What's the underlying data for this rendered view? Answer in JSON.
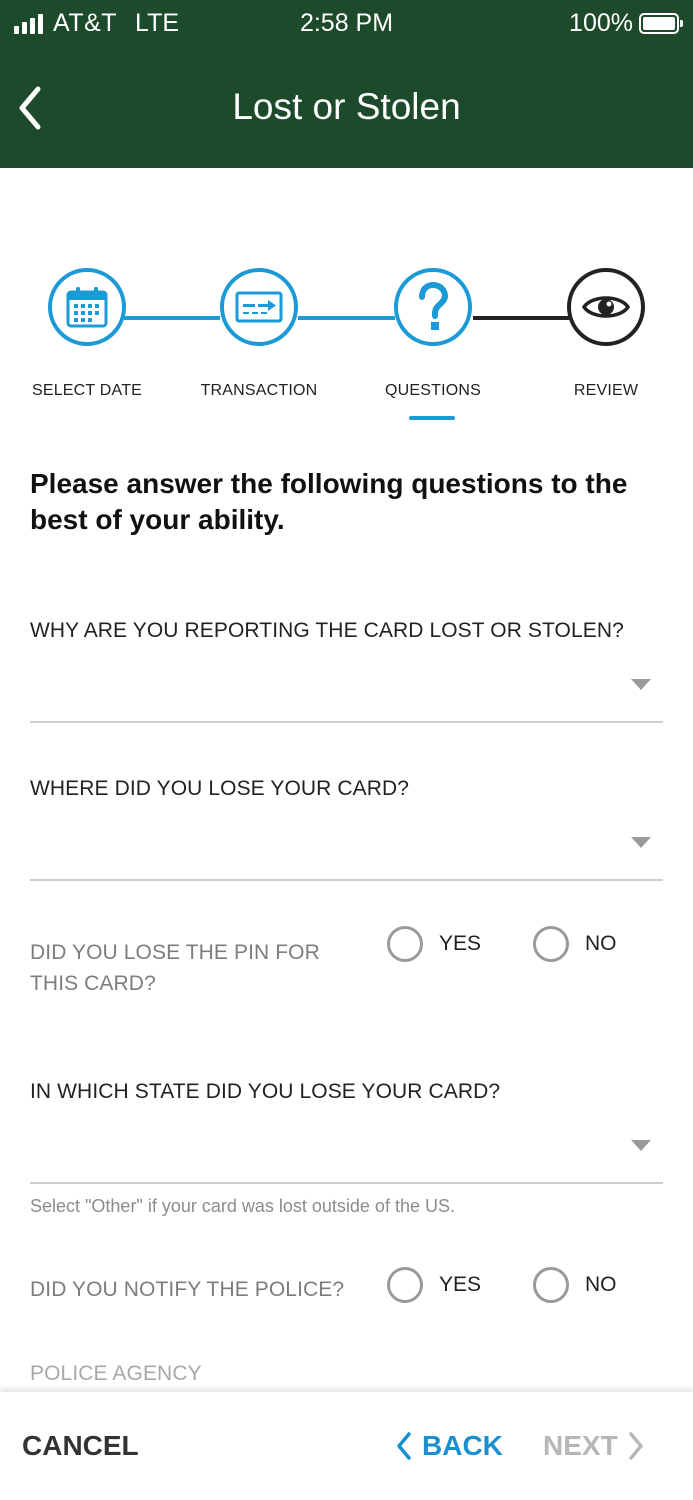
{
  "status_bar": {
    "carrier": "AT&T",
    "network": "LTE",
    "time": "2:58 PM",
    "battery": "100%",
    "battery_level": 1.0
  },
  "header": {
    "title": "Lost or Stolen",
    "back_icon": "chevron-left-icon",
    "background": "#1d4a2a"
  },
  "stepper": {
    "steps": [
      {
        "label": "SELECT DATE",
        "icon": "calendar-icon",
        "state": "done"
      },
      {
        "label": "TRANSACTION",
        "icon": "card-transfer-icon",
        "state": "done"
      },
      {
        "label": "QUESTIONS",
        "icon": "question-mark-icon",
        "state": "active"
      },
      {
        "label": "REVIEW",
        "icon": "eye-icon",
        "state": "upcoming"
      }
    ],
    "accent": "#1a9ad6"
  },
  "form": {
    "intro": "Please answer the following questions to the best of your ability.",
    "q1": {
      "label": "WHY ARE YOU REPORTING THE CARD LOST OR STOLEN?",
      "value": ""
    },
    "q2": {
      "label": "WHERE DID YOU LOSE YOUR CARD?",
      "value": ""
    },
    "q3": {
      "label_line1": "DID YOU LOSE THE PIN FOR",
      "label_line2": "THIS CARD?",
      "yes": "YES",
      "no": "NO"
    },
    "q4": {
      "label": "IN WHICH STATE DID YOU LOSE YOUR CARD?",
      "value": "",
      "hint": "Select \"Other\" if your card was lost outside of the US."
    },
    "q5": {
      "label": "DID YOU NOTIFY THE POLICE?",
      "yes": "YES",
      "no": "NO"
    },
    "q6": {
      "label": "POLICE AGENCY"
    }
  },
  "footer": {
    "cancel": "CANCEL",
    "back": "BACK",
    "next": "NEXT"
  }
}
